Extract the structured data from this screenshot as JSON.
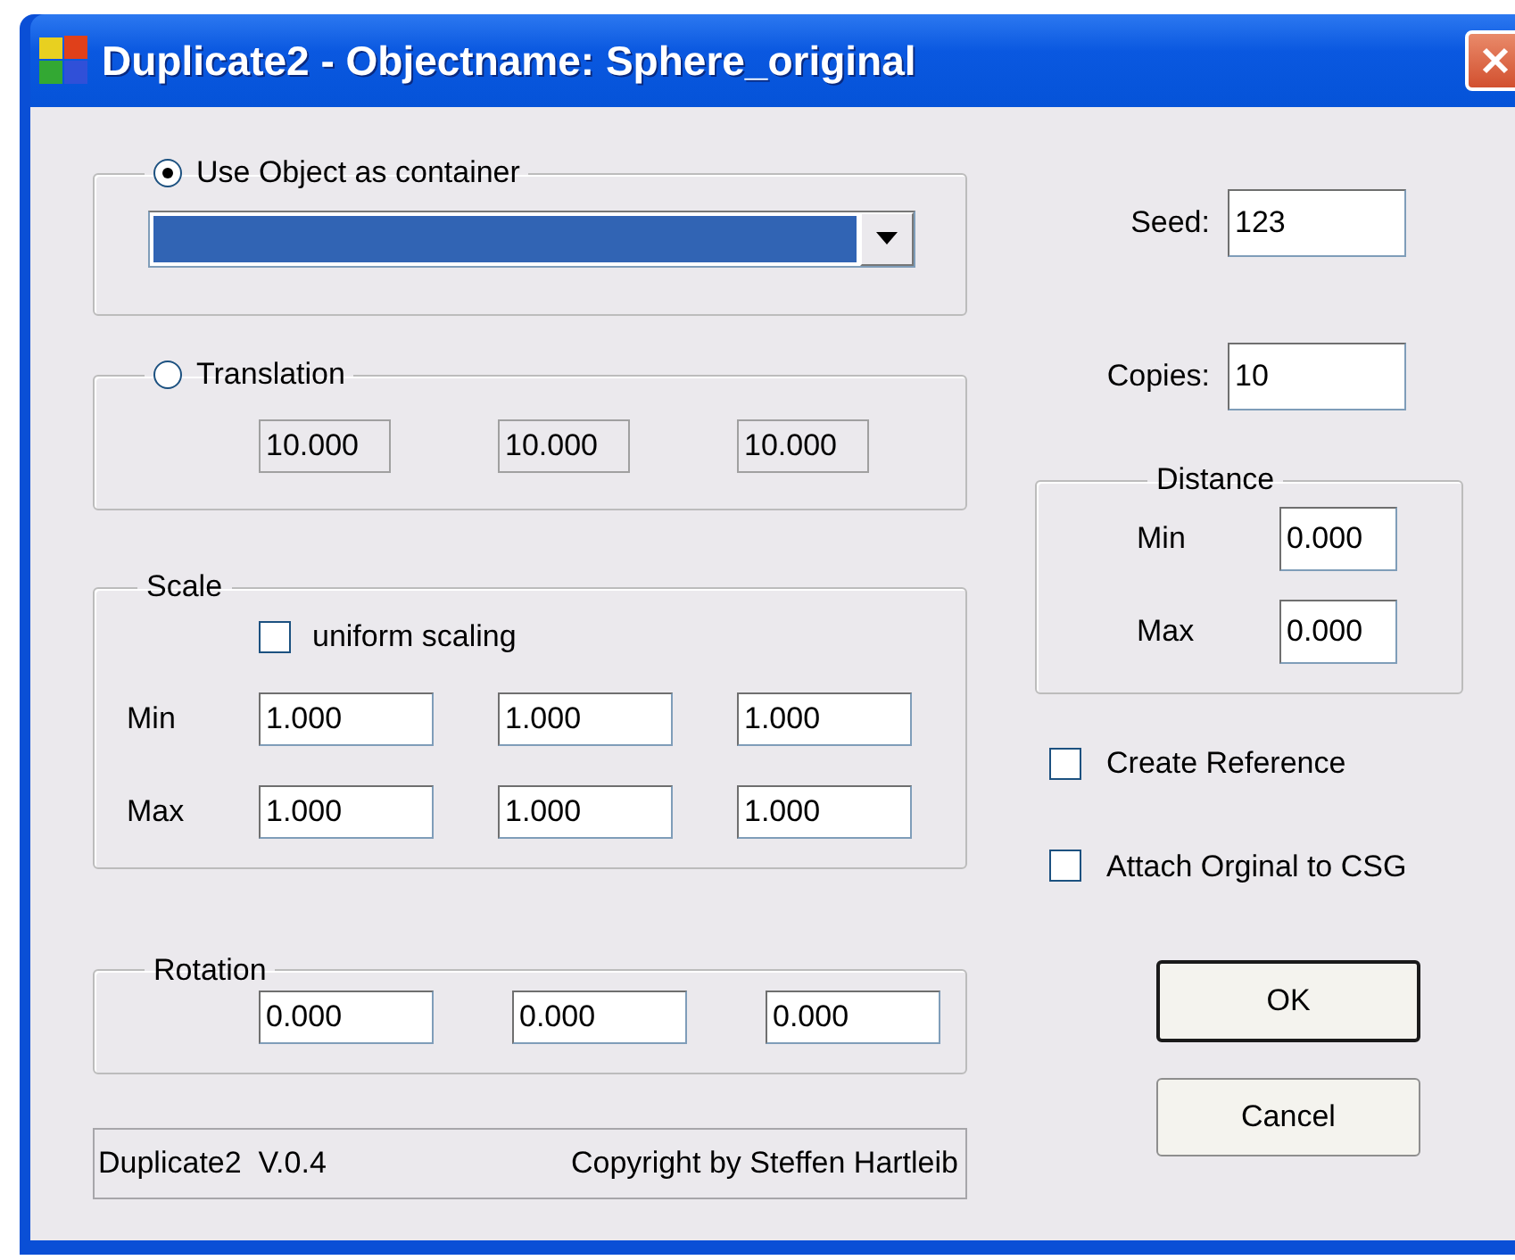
{
  "window": {
    "title": "Duplicate2 - Objectname: Sphere_original"
  },
  "container_group": {
    "label": "Use Object as container",
    "selected": true
  },
  "translation_group": {
    "label": "Translation",
    "selected": false,
    "fields": [
      {
        "value": "10.000",
        "disabled": true
      },
      {
        "value": "10.000",
        "disabled": true
      },
      {
        "value": "10.000",
        "disabled": true
      }
    ]
  },
  "scale": {
    "label": "Scale",
    "uniform": {
      "label": "uniform scaling",
      "checked": false
    },
    "rows": [
      {
        "label": "Min",
        "values": [
          "1.000",
          "1.000",
          "1.000"
        ]
      },
      {
        "label": "Max",
        "values": [
          "1.000",
          "1.000",
          "1.000"
        ]
      }
    ]
  },
  "rotation": {
    "label": "Rotation",
    "values": [
      "0.000",
      "0.000",
      "0.000"
    ]
  },
  "status": {
    "version": "Duplicate2  V.0.4",
    "copyright": "Copyright by Steffen Hartleib"
  },
  "seed": {
    "label": "Seed:",
    "value": "123"
  },
  "copies": {
    "label": "Copies:",
    "value": "10"
  },
  "distance": {
    "label": "Distance",
    "rows": [
      {
        "label": "Min",
        "value": "0.000"
      },
      {
        "label": "Max",
        "value": "0.000"
      }
    ]
  },
  "options": [
    {
      "label": "Create Reference",
      "checked": false
    },
    {
      "label": "Attach Orginal to CSG",
      "checked": false
    }
  ],
  "buttons": [
    {
      "label": "OK",
      "default": true
    },
    {
      "label": "Cancel",
      "default": false
    }
  ]
}
